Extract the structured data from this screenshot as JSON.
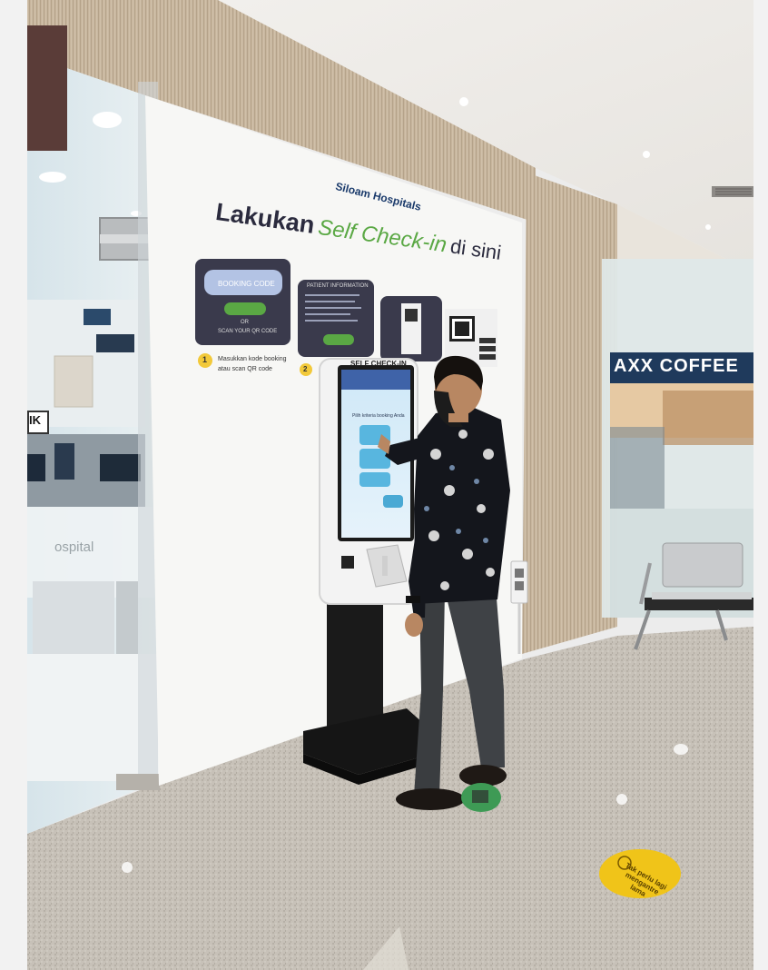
{
  "brand": {
    "logo_text": "Siloam Hospitals"
  },
  "mural": {
    "headline_part1": "Lakukan",
    "headline_part2": "Self Check-in",
    "headline_part3": "di sini",
    "card1": {
      "title": "BOOKING CODE",
      "or": "OR",
      "scan": "SCAN YOUR QR CODE"
    },
    "card2": {
      "title": "PATIENT INFORMATION"
    },
    "step1_number": "1",
    "step1_text_line1": "Masukkan kode booking",
    "step1_text_line2": "atau scan QR code",
    "step2_number": "2"
  },
  "kiosk": {
    "header_label": "SELF CHECK-IN",
    "screen_prompt": "Pilih kriteria booking Anda"
  },
  "background": {
    "cafe_sign": "AXX COFFEE",
    "door_label": "IK",
    "glass_text": "ospital"
  },
  "floor_sticker": {
    "line1": "Tak perlu lagi",
    "line2": "mengantre",
    "line3": "lama"
  },
  "colors": {
    "accent_green": "#5aa844",
    "card_dark": "#3a3a4c",
    "sticker_yellow": "#f0c419",
    "cafe_sign_blue": "#1f3a5c"
  }
}
